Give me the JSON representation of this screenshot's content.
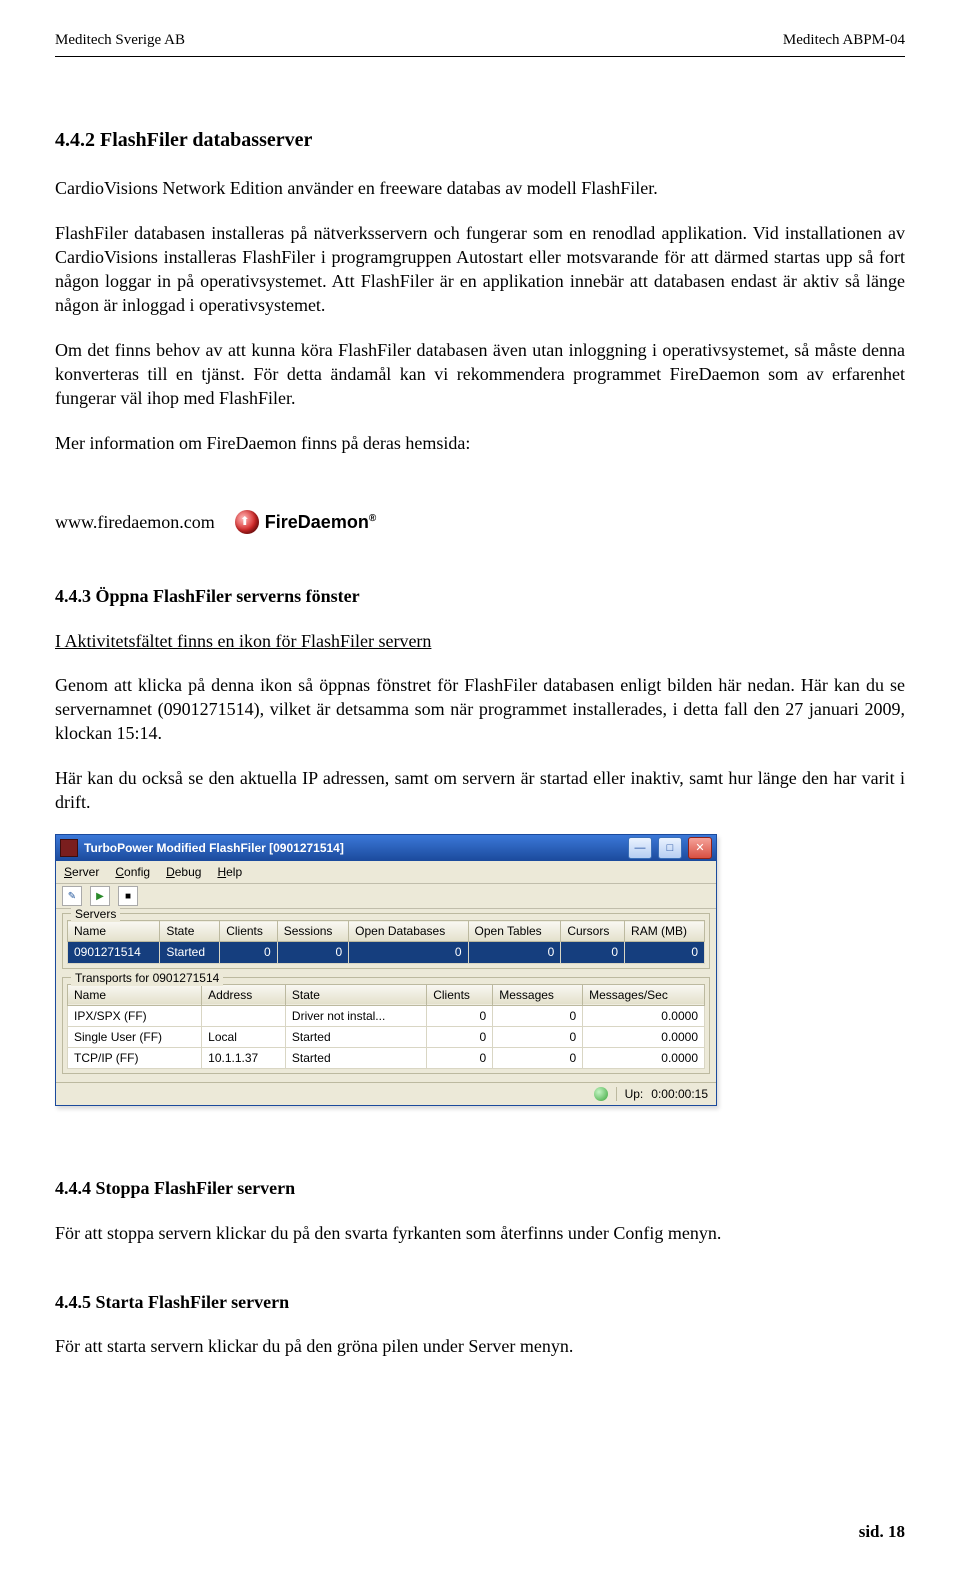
{
  "header": {
    "left": "Meditech Sverige AB",
    "right": "Meditech ABPM-04"
  },
  "section": {
    "h_442": "4.4.2  FlashFiler databasserver",
    "p1": "CardioVisions Network Edition använder en freeware databas av modell FlashFiler.",
    "p2": "FlashFiler databasen installeras på nätverksservern och fungerar som en renodlad applikation. Vid installationen av CardioVisions installeras FlashFiler i programgruppen Autostart eller motsvarande för att därmed startas upp så fort någon loggar in på operativsystemet. Att FlashFiler är en applikation innebär att databasen endast är aktiv så länge någon är inloggad i operativsystemet.",
    "p3": "Om det finns behov av att kunna köra FlashFiler databasen även utan inloggning i operativsystemet, så måste denna konverteras till en tjänst. För detta ändamål kan vi rekommendera programmet FireDaemon som av erfarenhet fungerar väl ihop med FlashFiler.",
    "p4": "Mer information om FireDaemon finns på deras hemsida:",
    "fd_link": "www.firedaemon.com",
    "fd_brand": "FireDaemon",
    "h_443": "4.4.3  Öppna FlashFiler serverns fönster",
    "p5": "I Aktivitetsfältet finns en ikon för FlashFiler servern",
    "p6": "Genom att klicka på denna ikon så öppnas fönstret för FlashFiler databasen enligt bilden här nedan. Här kan du se servernamnet (0901271514), vilket är detsamma som när programmet installerades, i detta fall den 27 januari 2009, klockan 15:14.",
    "p7": "Här kan du också se den aktuella IP adressen, samt om servern är startad eller inaktiv, samt hur länge den har varit i drift.",
    "h_444": "4.4.4  Stoppa FlashFiler servern",
    "p8": "För att stoppa servern klickar du på den svarta fyrkanten som återfinns under Config menyn.",
    "h_445": "4.4.5  Starta FlashFiler servern",
    "p9": "För att starta servern klickar du på den gröna pilen under Server menyn."
  },
  "ff": {
    "title": "TurboPower Modified FlashFiler [0901271514]",
    "menus": {
      "server": "Server",
      "config": "Config",
      "debug": "Debug",
      "help": "Help"
    },
    "servers": {
      "group_label": "Servers",
      "headers": [
        "Name",
        "State",
        "Clients",
        "Sessions",
        "Open Databases",
        "Open Tables",
        "Cursors",
        "RAM (MB)"
      ],
      "row": {
        "name": "0901271514",
        "state": "Started",
        "clients": "0",
        "sessions": "0",
        "opendb": "0",
        "opentbl": "0",
        "cursors": "0",
        "ram": "0"
      }
    },
    "transports": {
      "group_label": "Transports for 0901271514",
      "headers": [
        "Name",
        "Address",
        "State",
        "Clients",
        "Messages",
        "Messages/Sec"
      ],
      "rows": [
        {
          "name": "IPX/SPX (FF)",
          "address": "",
          "state": "Driver not instal...",
          "clients": "0",
          "messages": "0",
          "msgsec": "0.0000"
        },
        {
          "name": "Single User (FF)",
          "address": "Local",
          "state": "Started",
          "clients": "0",
          "messages": "0",
          "msgsec": "0.0000"
        },
        {
          "name": "TCP/IP (FF)",
          "address": "10.1.1.37",
          "state": "Started",
          "clients": "0",
          "messages": "0",
          "msgsec": "0.0000"
        }
      ]
    },
    "status": {
      "up_label": "Up:",
      "uptime": "0:00:00:15"
    }
  },
  "footer": {
    "page": "sid.  18"
  }
}
